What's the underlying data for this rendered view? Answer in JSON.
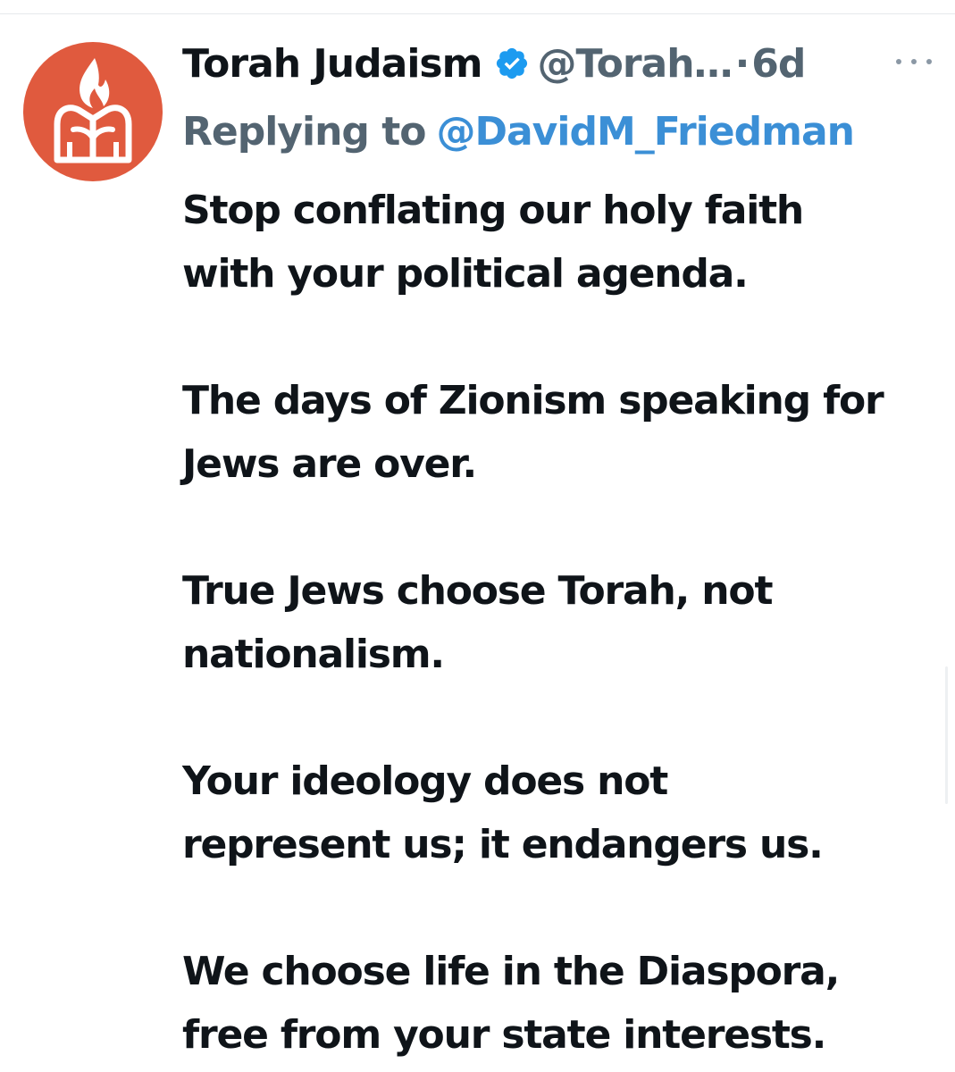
{
  "tweet": {
    "author": {
      "display_name": "Torah Judaism",
      "handle": "@Torah…",
      "verified": true,
      "avatar_color": "#e05a3e"
    },
    "separator": "·",
    "time_ago": "6d",
    "replying_to": {
      "prefix": "Replying to",
      "mention": "@DavidM_Friedman"
    },
    "paragraphs": [
      "Stop conflating our holy faith\nwith your political agenda.",
      "The days of Zionism speaking for\nJews are over.",
      "True Jews choose Torah, not\nnationalism.",
      "Your ideology does not\nrepresent us; it endangers us.",
      "We choose life in the Diaspora,\nfree from your state interests."
    ]
  },
  "colors": {
    "text_primary": "#0f1419",
    "text_secondary": "#536471",
    "link": "#3b8fd6",
    "verified": "#1d9bf0"
  }
}
